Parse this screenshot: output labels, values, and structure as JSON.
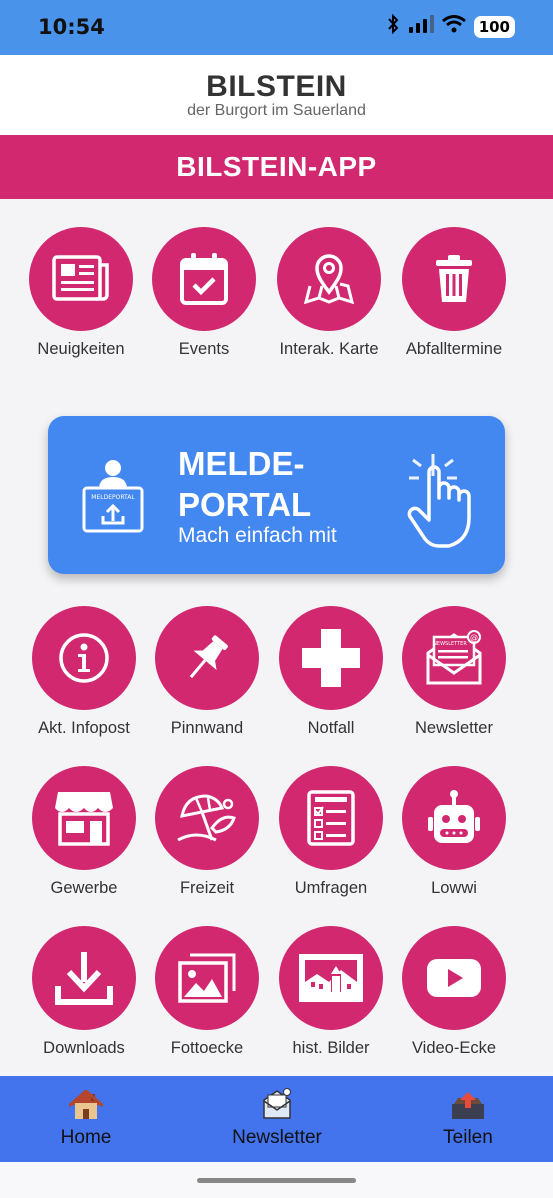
{
  "status": {
    "time": "10:54",
    "battery": "100"
  },
  "header": {
    "title": "BILSTEIN",
    "subtitle": "der Burgort im Sauerland"
  },
  "banner": {
    "title": "BILSTEIN-APP"
  },
  "tiles": [
    {
      "label": "Neuigkeiten",
      "icon": "newspaper-icon"
    },
    {
      "label": "Events",
      "icon": "calendar-icon"
    },
    {
      "label": "Interak. Karte",
      "icon": "map-icon"
    },
    {
      "label": "Abfalltermine",
      "icon": "trash-icon"
    },
    {
      "label": "Akt. Infopost",
      "icon": "info-icon"
    },
    {
      "label": "Pinnwand",
      "icon": "pin-icon"
    },
    {
      "label": "Notfall",
      "icon": "cross-icon"
    },
    {
      "label": "Newsletter",
      "icon": "newsletter-icon",
      "badge": "NEWSLETTER"
    },
    {
      "label": "Gewerbe",
      "icon": "shop-icon"
    },
    {
      "label": "Freizeit",
      "icon": "leisure-icon"
    },
    {
      "label": "Umfragen",
      "icon": "survey-icon"
    },
    {
      "label": "Lowwi",
      "icon": "robot-icon"
    },
    {
      "label": "Downloads",
      "icon": "download-icon"
    },
    {
      "label": "Fottoecke",
      "icon": "photos-icon"
    },
    {
      "label": "hist. Bilder",
      "icon": "castle-icon"
    },
    {
      "label": "Video-Ecke",
      "icon": "video-icon"
    }
  ],
  "portal": {
    "title": "MELDE-\nPORTAL",
    "subtitle": "Mach einfach mit",
    "badge": "MELDEPORTAL"
  },
  "nav": [
    {
      "label": "Home",
      "icon": "house-icon"
    },
    {
      "label": "Newsletter",
      "icon": "envelope-icon"
    },
    {
      "label": "Teilen",
      "icon": "share-icon"
    }
  ],
  "colors": {
    "accent": "#d1286f",
    "blue": "#4387f0",
    "nav": "#4374ee",
    "status": "#4a93ea"
  }
}
